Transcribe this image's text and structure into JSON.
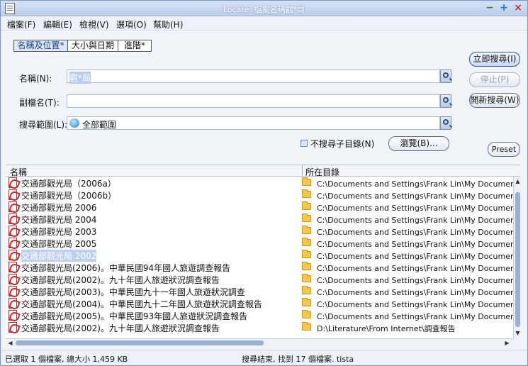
{
  "window": {
    "title": "Locate: 檔案名稱觀*局"
  },
  "menu": [
    "檔案(F)",
    "編輯(E)",
    "檢視(V)",
    "選項(O)",
    "幫助(H)"
  ],
  "tabs": [
    "名稱及位置*",
    "大小與日期",
    "進階*"
  ],
  "form": {
    "name_label": "名稱(N):",
    "name_value": "觀*局",
    "ext_label": "副檔名(T):",
    "ext_value": "",
    "scope_label": "搜尋範圍(L):",
    "scope_value": "全部範圍",
    "nosub_label": "不搜尋子目錄(N)",
    "browse_label": "瀏覽(B)..."
  },
  "buttons": {
    "search_now": "立即搜尋(I)",
    "stop": "停止(P)",
    "new_search": "開新搜尋(W)",
    "preset": "Preset"
  },
  "columns": {
    "name": "名稱",
    "location": "所在目錄"
  },
  "rows": [
    {
      "name": "交通部觀光局（2006a）",
      "path": "C:\\Documents and Settings\\Frank Lin\\My Documents\\作業",
      "selected": false
    },
    {
      "name": "交通部觀光局（2006b）",
      "path": "C:\\Documents and Settings\\Frank Lin\\My Documents\\作業",
      "selected": false
    },
    {
      "name": "交通部觀光局 2006",
      "path": "C:\\Documents and Settings\\Frank Lin\\My Documents\\作業",
      "selected": false
    },
    {
      "name": "交通部觀光局 2004",
      "path": "C:\\Documents and Settings\\Frank Lin\\My Documents\\作業",
      "selected": false
    },
    {
      "name": "交通部觀光局 2003",
      "path": "C:\\Documents and Settings\\Frank Lin\\My Documents\\作業",
      "selected": false
    },
    {
      "name": "交通部觀光局 2005",
      "path": "C:\\Documents and Settings\\Frank Lin\\My Documents\\作業",
      "selected": false
    },
    {
      "name": "交通部觀光局 2002",
      "path": "C:\\Documents and Settings\\Frank Lin\\My Documents\\作業",
      "selected": true
    },
    {
      "name": "交通部觀光局(2006)。中華民國94年國人旅遊調查報告",
      "path": "C:\\Documents and Settings\\Frank Lin\\My Documents\\作業",
      "selected": false
    },
    {
      "name": "交通部觀光局(2002)。九十年國人旅遊狀況調查報告",
      "path": "C:\\Documents and Settings\\Frank Lin\\My Documents\\作業",
      "selected": false
    },
    {
      "name": "交通部觀光局(2003)。中華民國九十一年國人旅遊狀況調查",
      "path": "C:\\Documents and Settings\\Frank Lin\\My Documents\\作業",
      "selected": false
    },
    {
      "name": "交通部觀光局(2004)。中華民國九十二年國人旅遊狀況調查報告",
      "path": "C:\\Documents and Settings\\Frank Lin\\My Documents\\作業",
      "selected": false
    },
    {
      "name": "交通部觀光局(2005)。中華民國93年國人旅遊狀況調查報告",
      "path": "C:\\Documents and Settings\\Frank Lin\\My Documents\\作業",
      "selected": false
    },
    {
      "name": "交通部觀光局(2002)。九十年國人旅遊狀況調查報告",
      "path": "D:\\Literature\\From Internet\\調查報告",
      "selected": false
    }
  ],
  "status": {
    "left": "已選取 1 個檔案, 總大小 1,459 KB",
    "right": "搜尋結束, 找到 17 個檔案. tista"
  }
}
